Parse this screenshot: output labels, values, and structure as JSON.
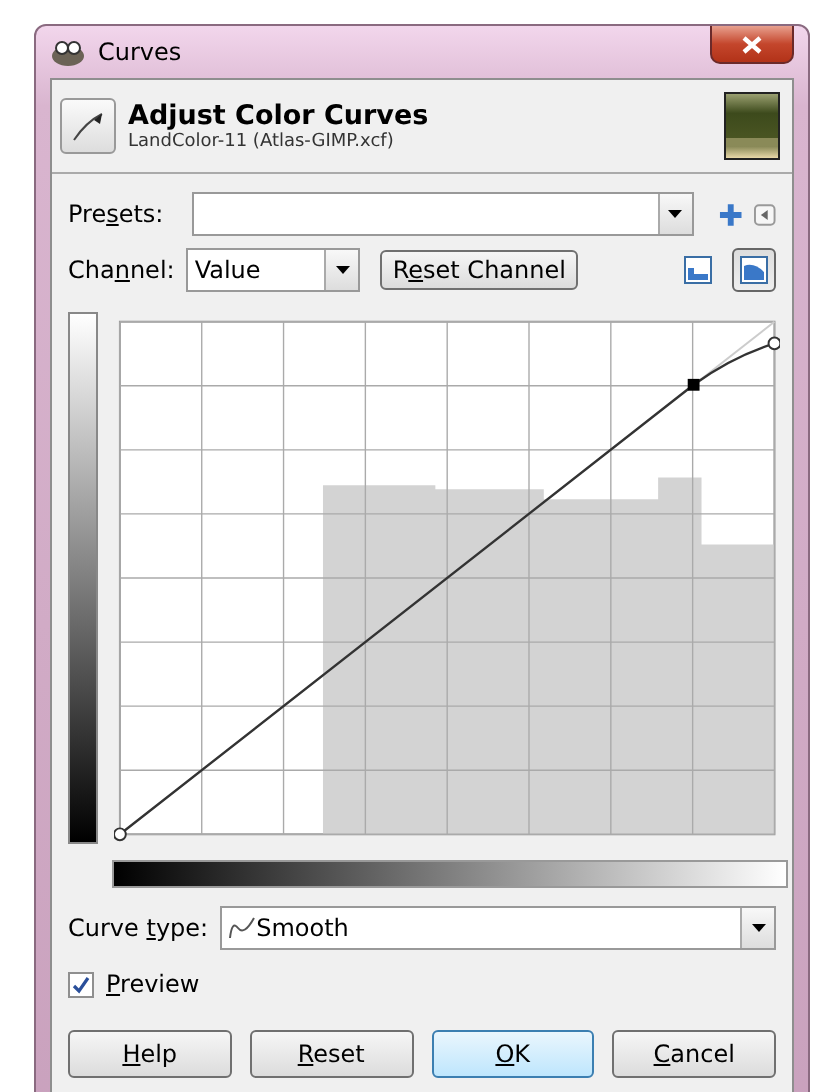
{
  "window": {
    "title": "Curves"
  },
  "header": {
    "title": "Adjust Color Curves",
    "subtitle": "LandColor-11 (Atlas-GIMP.xcf)"
  },
  "presets": {
    "label": {
      "before": "Pre",
      "key": "s",
      "after": "ets:"
    }
  },
  "channel": {
    "label": {
      "before": "Cha",
      "key": "n",
      "after": "nel:"
    },
    "value": "Value",
    "reset": {
      "before": "R",
      "key": "e",
      "after": "set Channel"
    }
  },
  "scale_buttons": [
    {
      "kind": "linear",
      "selected": false
    },
    {
      "kind": "log",
      "selected": true
    }
  ],
  "curve_type": {
    "label": {
      "before": "Curve ",
      "key": "t",
      "after": "ype:"
    },
    "value": "Smooth"
  },
  "preview": {
    "label": {
      "key": "P",
      "after": "review"
    },
    "checked": true
  },
  "buttons": [
    {
      "label": {
        "key": "H",
        "after": "elp"
      },
      "selected": false
    },
    {
      "label": {
        "key": "R",
        "after": "eset"
      },
      "selected": false
    },
    {
      "label": {
        "key": "O",
        "after": "K"
      },
      "selected": true
    },
    {
      "label": {
        "key": "C",
        "after": "ancel"
      },
      "selected": false
    }
  ]
}
